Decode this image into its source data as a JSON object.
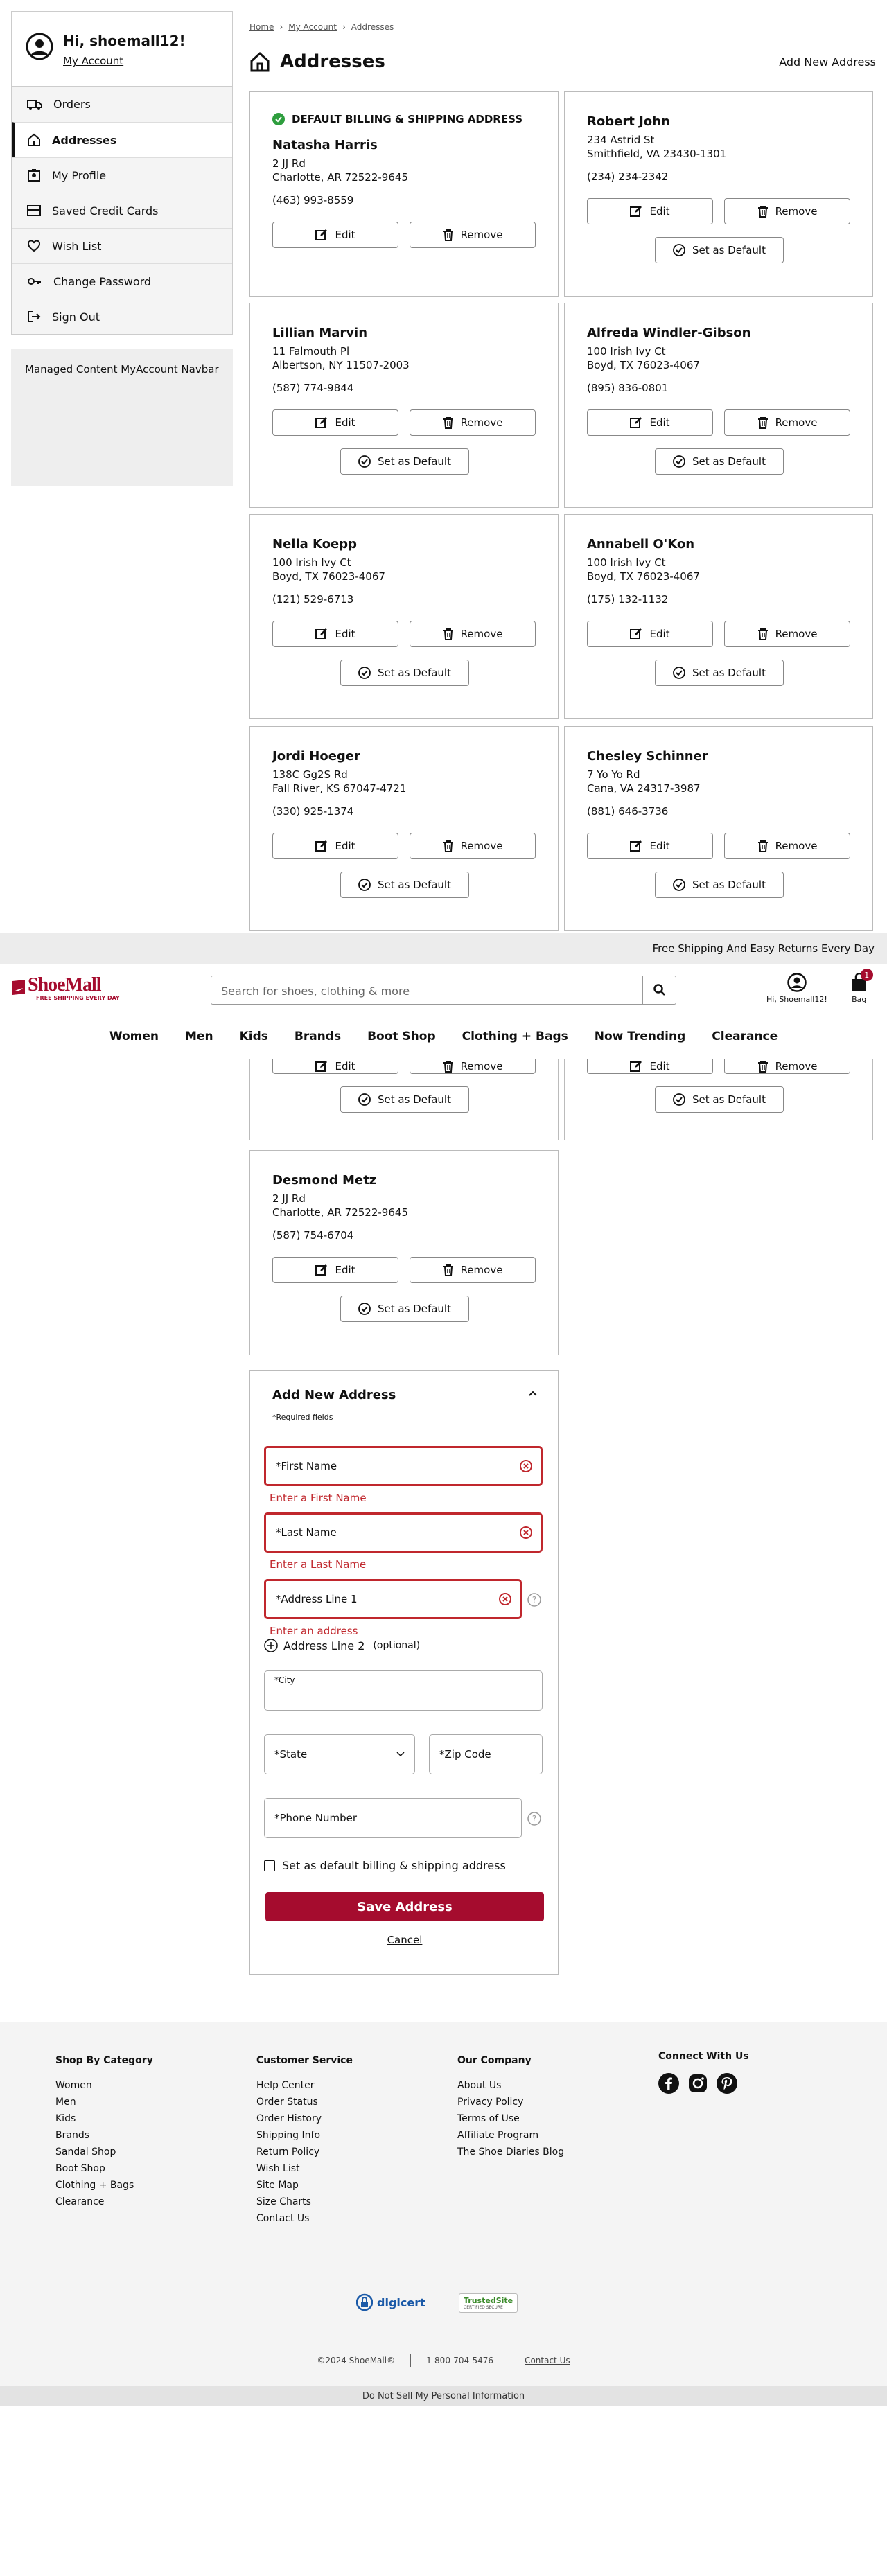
{
  "sidebar": {
    "greeting": "Hi, shoemall12!",
    "my_account": "My Account",
    "items": [
      {
        "label": "Orders",
        "icon": "truck-icon"
      },
      {
        "label": "Addresses",
        "icon": "home-icon"
      },
      {
        "label": "My Profile",
        "icon": "profile-icon"
      },
      {
        "label": "Saved Credit Cards",
        "icon": "credit-card-icon"
      },
      {
        "label": "Wish List",
        "icon": "heart-icon"
      },
      {
        "label": "Change Password",
        "icon": "key-icon"
      },
      {
        "label": "Sign Out",
        "icon": "sign-out-icon"
      }
    ],
    "managed_content": "Managed Content MyAccount Navbar"
  },
  "breadcrumb": {
    "home": "Home",
    "account": "My Account",
    "current": "Addresses"
  },
  "page": {
    "title": "Addresses",
    "add_new": "Add New Address"
  },
  "buttons": {
    "edit": "Edit",
    "remove": "Remove",
    "set_default": "Set as Default"
  },
  "default_label": "DEFAULT BILLING & SHIPPING ADDRESS",
  "addresses": [
    {
      "name": "Natasha Harris",
      "line1": "2 JJ Rd",
      "line2": "Charlotte, AR 72522-9645",
      "phone": "(463) 993-8559"
    },
    {
      "name": "Robert John",
      "line1": "234 Astrid St",
      "line2": "Smithfield, VA 23430-1301",
      "phone": "(234) 234-2342"
    },
    {
      "name": "Lillian Marvin",
      "line1": "11 Falmouth Pl",
      "line2": "Albertson, NY 11507-2003",
      "phone": "(587) 774-9844"
    },
    {
      "name": "Alfreda Windler-Gibson",
      "line1": "100 Irish Ivy Ct",
      "line2": "Boyd, TX 76023-4067",
      "phone": "(895) 836-0801"
    },
    {
      "name": "Nella Koepp",
      "line1": "100 Irish Ivy Ct",
      "line2": "Boyd, TX 76023-4067",
      "phone": "(121) 529-6713"
    },
    {
      "name": "Annabell O'Kon",
      "line1": "100 Irish Ivy Ct",
      "line2": "Boyd, TX 76023-4067",
      "phone": "(175) 132-1132"
    },
    {
      "name": "Jordi Hoeger",
      "line1": "138C Gg2S Rd",
      "line2": "Fall River, KS 67047-4721",
      "phone": "(330) 925-1374"
    },
    {
      "name": "Chesley Schinner",
      "line1": "7 Yo Yo Rd",
      "line2": "Cana, VA 24317-3987",
      "phone": "(881) 646-3736"
    },
    {
      "name": "Desmond Metz",
      "line1": "2 JJ Rd",
      "line2": "Charlotte, AR 72522-9645",
      "phone": "(587) 754-6704"
    }
  ],
  "banner": "Free Shipping And Easy Returns Every Day",
  "header": {
    "logo": "ShoeMall",
    "logo_tagline": "FREE SHIPPING EVERY DAY",
    "search_placeholder": "Search for shoes, clothing & more",
    "account_label": "Hi, Shoemall12!",
    "bag_label": "Bag",
    "bag_count": "1",
    "nav": [
      "Women",
      "Men",
      "Kids",
      "Brands",
      "Boot Shop",
      "Clothing + Bags",
      "Now Trending",
      "Clearance"
    ]
  },
  "form": {
    "title": "Add New Address",
    "required_note": "*Required fields",
    "first_name": "*First Name",
    "first_name_error": "Enter a First Name",
    "last_name": "*Last Name",
    "last_name_error": "Enter a Last Name",
    "address1": "*Address Line 1",
    "address1_error": "Enter an address",
    "address2": "Address Line 2",
    "address2_optional": "(optional)",
    "city": "*City",
    "state": "*State",
    "zip": "*Zip Code",
    "phone": "*Phone Number",
    "default_checkbox": "Set as default billing & shipping address",
    "save": "Save Address",
    "cancel": "Cancel"
  },
  "footer": {
    "shop_heading": "Shop By Category",
    "shop": [
      "Women",
      "Men",
      "Kids",
      "Brands",
      "Sandal Shop",
      "Boot Shop",
      "Clothing + Bags",
      "Clearance"
    ],
    "service_heading": "Customer Service",
    "service": [
      "Help Center",
      "Order Status",
      "Order History",
      "Shipping Info",
      "Return Policy",
      "Wish List",
      "Site Map",
      "Size Charts",
      "Contact Us"
    ],
    "company_heading": "Our Company",
    "company": [
      "About Us",
      "Privacy Policy",
      "Terms of Use",
      "Affiliate Program",
      "The Shoe Diaries Blog"
    ],
    "connect_heading": "Connect With Us",
    "digicert": "digicert",
    "trustedsite": "TrustedSite",
    "trustedsite_sub": "CERTIFIED SECURE",
    "copyright": "©2024 ShoeMall®",
    "phone": "1-800-704-5476",
    "contact": "Contact Us",
    "do_not_sell": "Do Not Sell My Personal Information"
  },
  "colors": {
    "brand": "#a50c2e",
    "error": "#c0272d",
    "check_green": "#2e9e3e"
  }
}
